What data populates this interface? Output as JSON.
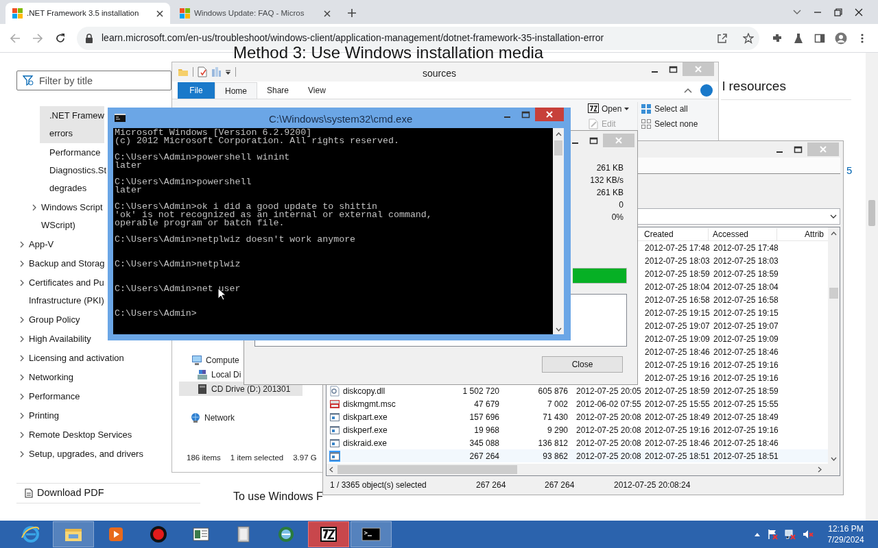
{
  "browser": {
    "tabs": [
      {
        "title": ".NET Framework 3.5 installation",
        "selected": true
      },
      {
        "title": "Windows Update: FAQ - Micros",
        "selected": false
      }
    ],
    "url": "learn.microsoft.com/en-us/troubleshoot/windows-client/application-management/dotnet-framework-35-installation-error",
    "sidebar": {
      "filter_placeholder": "Filter by title",
      "items": [
        {
          "children": [
            {
              "lines": [
                ".NET Framew",
                "errors"
              ],
              "selected": true
            },
            {
              "lines": [
                "Performance",
                "Diagnostics.St",
                "degrades"
              ],
              "selected": false
            },
            {
              "lines": [
                "Windows Script",
                "WScript)"
              ],
              "selected": false,
              "expanded": false
            }
          ]
        },
        {
          "lines": [
            "App-V"
          ],
          "selected": false,
          "expanded": false
        },
        {
          "lines": [
            "Backup and Storag"
          ],
          "selected": false,
          "expanded": false
        },
        {
          "lines": [
            "Certificates and Pu",
            "Infrastructure (PKI)"
          ],
          "selected": false,
          "expanded": false
        },
        {
          "lines": [
            "Group Policy"
          ],
          "selected": false,
          "expanded": false
        },
        {
          "lines": [
            "High Availability"
          ],
          "selected": false,
          "expanded": false
        },
        {
          "lines": [
            "Licensing and activation"
          ],
          "selected": false,
          "expanded": false
        },
        {
          "lines": [
            "Networking"
          ],
          "selected": false,
          "expanded": false
        },
        {
          "lines": [
            "Performance"
          ],
          "selected": false,
          "expanded": false
        },
        {
          "lines": [
            "Printing"
          ],
          "selected": false,
          "expanded": false
        },
        {
          "lines": [
            "Remote Desktop Services"
          ],
          "selected": false,
          "expanded": false
        },
        {
          "lines": [
            "Setup, upgrades, and drivers"
          ],
          "selected": false,
          "expanded": false
        }
      ],
      "download": "Download PDF"
    },
    "heading": "Method 3: Use Windows installation media",
    "aside_heading": "l resources",
    "aside_link": "5",
    "paragraph": "To use Windows F"
  },
  "explorer": {
    "title": "sources",
    "ribbon_tabs": [
      {
        "label": "File",
        "kind": "file",
        "selected": false
      },
      {
        "label": "Home",
        "kind": "tab",
        "selected": true
      },
      {
        "label": "Share",
        "kind": "tab",
        "selected": false
      },
      {
        "label": "View",
        "kind": "tab",
        "selected": false
      }
    ],
    "commands": [
      [
        {
          "label": "Open",
          "kind": "open",
          "disabled": false
        },
        {
          "label": "Edit",
          "kind": "edit",
          "disabled": true
        }
      ],
      [
        {
          "label": "Select all",
          "kind": "select_all",
          "disabled": false
        },
        {
          "label": "Select none",
          "kind": "select_none",
          "disabled": false
        }
      ]
    ],
    "nav": [
      {
        "label": "Compute",
        "kind": "computer",
        "selected": false
      },
      {
        "label": "Local Di",
        "kind": "drive",
        "selected": false
      },
      {
        "label": "CD Drive (D:) 201301",
        "kind": "cd",
        "selected": true
      },
      {
        "label": "Network",
        "kind": "network",
        "selected": false
      }
    ],
    "status": [
      "186 items",
      "1 item selected",
      "3.97 G"
    ]
  },
  "progress": {
    "values": [
      "261 KB",
      "132 KB/s",
      "261 KB",
      "0",
      "0%"
    ],
    "level": 1,
    "close": "Close"
  },
  "archive": {
    "columns": [
      {
        "label": "Created"
      },
      {
        "label": "Accessed"
      },
      {
        "label": "Attrib"
      }
    ],
    "rows": [
      {
        "created": "2012-07-25 17:48",
        "accessed": "2012-07-25 17:48",
        "selected": false
      },
      {
        "created": "2012-07-25 18:03",
        "accessed": "2012-07-25 18:03",
        "selected": false
      },
      {
        "created": "2012-07-25 18:59",
        "accessed": "2012-07-25 18:59",
        "selected": false
      },
      {
        "created": "2012-07-25 18:04",
        "accessed": "2012-07-25 18:04",
        "selected": false
      },
      {
        "created": "2012-07-25 16:58",
        "accessed": "2012-07-25 16:58",
        "selected": false
      },
      {
        "created": "2012-07-25 19:15",
        "accessed": "2012-07-25 19:15",
        "selected": false
      },
      {
        "created": "2012-07-25 19:07",
        "accessed": "2012-07-25 19:07",
        "selected": false
      },
      {
        "created": "2012-07-25 19:09",
        "accessed": "2012-07-25 19:09",
        "selected": false
      },
      {
        "created": "2012-07-25 18:46",
        "accessed": "2012-07-25 18:46",
        "selected": false
      },
      {
        "created": "2012-07-25 19:16",
        "accessed": "2012-07-25 19:16",
        "selected": false
      },
      {
        "created": "2012-07-25 19:16",
        "accessed": "2012-07-25 19:16",
        "selected": false
      },
      {
        "kind": "dll",
        "name": "diskcopy.dll",
        "size": "1 502 720",
        "packed": "605 876",
        "modified": "2012-07-25 20:05",
        "created": "2012-07-25 18:59",
        "accessed": "2012-07-25 18:59",
        "selected": false
      },
      {
        "kind": "msc",
        "name": "diskmgmt.msc",
        "size": "47 679",
        "packed": "7 002",
        "modified": "2012-06-02 07:55",
        "created": "2012-07-25 15:55",
        "accessed": "2012-07-25 15:55",
        "selected": false
      },
      {
        "kind": "exe",
        "name": "diskpart.exe",
        "size": "157 696",
        "packed": "71 430",
        "modified": "2012-07-25 20:08",
        "created": "2012-07-25 18:49",
        "accessed": "2012-07-25 18:49",
        "selected": false
      },
      {
        "kind": "exe",
        "name": "diskperf.exe",
        "size": "19 968",
        "packed": "9 290",
        "modified": "2012-07-25 20:08",
        "created": "2012-07-25 19:16",
        "accessed": "2012-07-25 19:16",
        "selected": false
      },
      {
        "kind": "exe",
        "name": "diskraid.exe",
        "size": "345 088",
        "packed": "136 812",
        "modified": "2012-07-25 20:08",
        "created": "2012-07-25 18:46",
        "accessed": "2012-07-25 18:46",
        "selected": false
      },
      {
        "kind": "exe",
        "size": "267 264",
        "packed": "93 862",
        "modified": "2012-07-25 20:08",
        "created": "2012-07-25 18:51",
        "accessed": "2012-07-25 18:51",
        "selected": true
      }
    ],
    "status": [
      "1 / 3365 object(s) selected",
      "267 264",
      "267 264",
      "2012-07-25 20:08:24"
    ]
  },
  "cmd": {
    "title": "C:\\Windows\\system32\\cmd.exe",
    "header": [
      "Microsoft Windows [Version 6.2.9200]",
      "(c) 2012 Microsoft Corporation. All rights reserved."
    ],
    "entries": [
      {
        "prompt": "C:\\Users\\Admin>",
        "command": "powershell winint",
        "output": [
          "later"
        ]
      },
      {
        "prompt": "C:\\Users\\Admin>",
        "command": "powershell",
        "output": [
          "later"
        ]
      },
      {
        "prompt": "C:\\Users\\Admin>",
        "command": "ok i did a good update to shittin",
        "output": [
          "'ok' is not recognized as an internal or external command,",
          "operable program or batch file."
        ]
      },
      {
        "prompt": "C:\\Users\\Admin>",
        "command": "netplwiz doesn't work anymore"
      },
      {
        "prompt": "C:\\Users\\Admin>",
        "command": "netplwiz"
      },
      {
        "prompt": "C:\\Users\\Admin>",
        "command": "net user"
      },
      {
        "prompt": "C:\\Users\\Admin>"
      }
    ]
  },
  "taskbar": {
    "apps": [
      {
        "kind": "ie",
        "running": false
      },
      {
        "kind": "explorer",
        "running": true
      },
      {
        "kind": "media",
        "running": false
      },
      {
        "kind": "record",
        "running": false
      },
      {
        "kind": "viewer",
        "running": false
      },
      {
        "kind": "files",
        "running": false
      },
      {
        "kind": "globe",
        "running": false
      },
      {
        "kind": "sevenzip",
        "running": true
      },
      {
        "kind": "cmd",
        "running": true
      }
    ],
    "time": "12:16 PM",
    "date": "7/29/2024"
  }
}
